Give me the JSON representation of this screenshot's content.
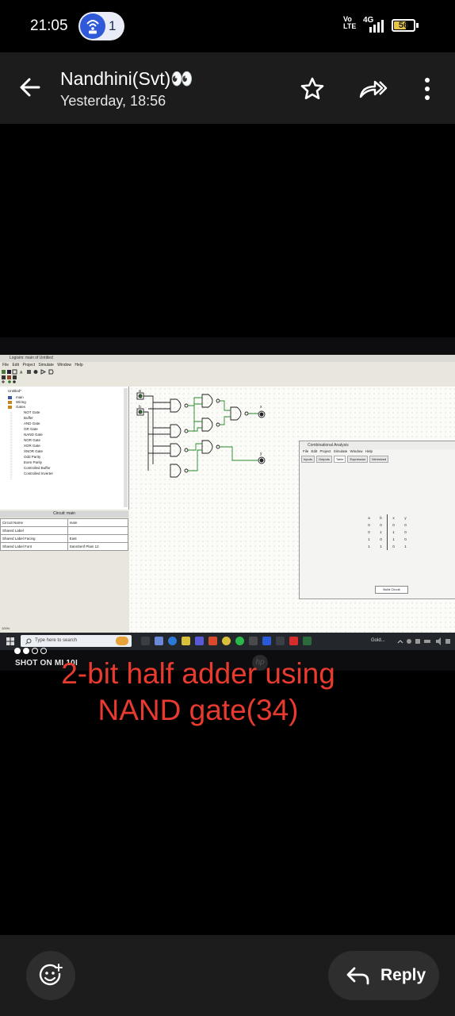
{
  "status_bar": {
    "time": "21:05",
    "hotspot_count": "1",
    "volte_top": "Vo",
    "volte_bottom": "LTE",
    "network": "4G",
    "battery": "56"
  },
  "header": {
    "contact_name": "Nandhini(Svt)👀",
    "timestamp": "Yesterday, 18:56",
    "icons": [
      "back-arrow-icon",
      "star-icon",
      "forward-icon",
      "more-vert-icon"
    ]
  },
  "photo": {
    "window_title": "Logisim: main of Untitled",
    "menu": "File Edit Project Simulate Window Help",
    "tree": {
      "root": "Untitled*",
      "items": [
        "main",
        "Wiring",
        "Gates",
        "NOT Gate",
        "Buffer",
        "AND Gate",
        "OR Gate",
        "NAND Gate",
        "NOR Gate",
        "XOR Gate",
        "XNOR Gate",
        "Odd Parity",
        "Even Parity",
        "Controlled Buffer",
        "Controlled Inverter"
      ]
    },
    "circuit_header": "Circuit: main",
    "attributes": [
      [
        "Circuit Name",
        "main"
      ],
      [
        "Shared Label",
        ""
      ],
      [
        "Shared Label Facing",
        "East"
      ],
      [
        "Shared Label Font",
        "SansSerif Plain 12"
      ]
    ],
    "zoom": "100%",
    "dialog": {
      "title": "Combinational Analysis",
      "menu": "File Edit Project Simulate Window Help",
      "tabs": [
        "Inputs",
        "Outputs",
        "Table",
        "Expression",
        "Minimized"
      ],
      "active_tab": "Table",
      "truth_header": [
        "a",
        "b",
        "x",
        "y"
      ],
      "truth_rows": [
        [
          "0",
          "0",
          "0",
          "0"
        ],
        [
          "0",
          "1",
          "1",
          "0"
        ],
        [
          "1",
          "0",
          "1",
          "0"
        ],
        [
          "1",
          "1",
          "0",
          "1"
        ]
      ],
      "build_button": "Build Circuit"
    },
    "taskbar": {
      "search_placeholder": "Type here to search",
      "tray_label": "Gold..."
    },
    "shot_on": "SHOT ON MI 10I"
  },
  "caption": {
    "line1": "2-bit half adder using",
    "line2": "NAND gate(34)"
  },
  "bottom_bar": {
    "reply_label": "Reply"
  },
  "colors": {
    "caption": "#e83a2f",
    "hotspot": "#2f59d8",
    "battery": "#e8c64a"
  }
}
